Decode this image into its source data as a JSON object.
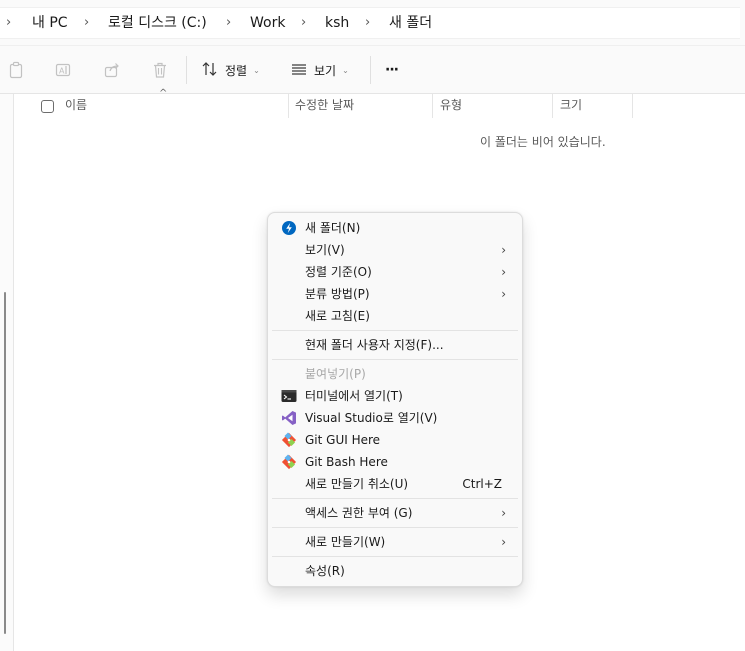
{
  "breadcrumb": {
    "items": [
      "내 PC",
      "로컬 디스크 (C:)",
      "Work",
      "ksh",
      "새 폴더"
    ],
    "separator": "›"
  },
  "toolbar": {
    "sort_label": "정렬",
    "view_label": "보기",
    "more_label": "···"
  },
  "columns": {
    "name": "이름",
    "modified": "수정한 날짜",
    "type": "유형",
    "size": "크기"
  },
  "empty_message": "이 폴더는 비어 있습니다.",
  "context_menu": {
    "new_folder": "새 폴더(N)",
    "view": "보기(V)",
    "sort_by": "정렬 기준(O)",
    "group_by": "분류 방법(P)",
    "refresh": "새로 고침(E)",
    "customize": "현재 폴더 사용자 지정(F)...",
    "paste": "붙여넣기(P)",
    "open_terminal": "터미널에서 열기(T)",
    "open_vs": "Visual Studio로 열기(V)",
    "git_gui": "Git GUI Here",
    "git_bash": "Git Bash Here",
    "undo_new": "새로 만들기 취소(U)",
    "undo_shortcut": "Ctrl+Z",
    "give_access": "액세스 권한 부여 (G)",
    "new": "새로 만들기(W)",
    "properties": "속성(R)",
    "submenu_arrow": "›"
  },
  "colors": {
    "accent": "#0067c0",
    "vs_purple": "#8661c5",
    "git_orange": "#f05133"
  }
}
